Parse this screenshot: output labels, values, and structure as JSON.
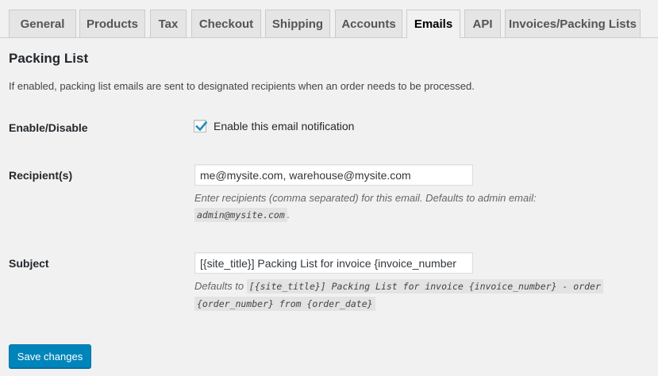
{
  "tabs": [
    {
      "label": "General"
    },
    {
      "label": "Products"
    },
    {
      "label": "Tax"
    },
    {
      "label": "Checkout"
    },
    {
      "label": "Shipping"
    },
    {
      "label": "Accounts"
    },
    {
      "label": "Emails",
      "active": true
    },
    {
      "label": "API"
    },
    {
      "label": "Invoices/Packing Lists"
    }
  ],
  "section": {
    "title": "Packing List",
    "description": "If enabled, packing list emails are sent to designated recipients when an order needs to be processed."
  },
  "enable": {
    "label": "Enable/Disable",
    "checkbox_label": "Enable this email notification",
    "checked": true
  },
  "recipients": {
    "label": "Recipient(s)",
    "value": "me@mysite.com, warehouse@mysite.com",
    "help_prefix": "Enter recipients (comma separated) for this email. Defaults to admin email:",
    "help_code": "admin@mysite.com",
    "help_suffix": "."
  },
  "subject": {
    "label": "Subject",
    "value": "[{site_title}] Packing List for invoice {invoice_number",
    "help_prefix": "Defaults to",
    "help_code_line1": "[{site_title}] Packing List for invoice {invoice_number} - order",
    "help_code_line2": "{order_number} from {order_date}"
  },
  "actions": {
    "save_label": "Save changes"
  },
  "colors": {
    "primary_button": "#0085ba",
    "checkmark": "#1e8cbe"
  }
}
